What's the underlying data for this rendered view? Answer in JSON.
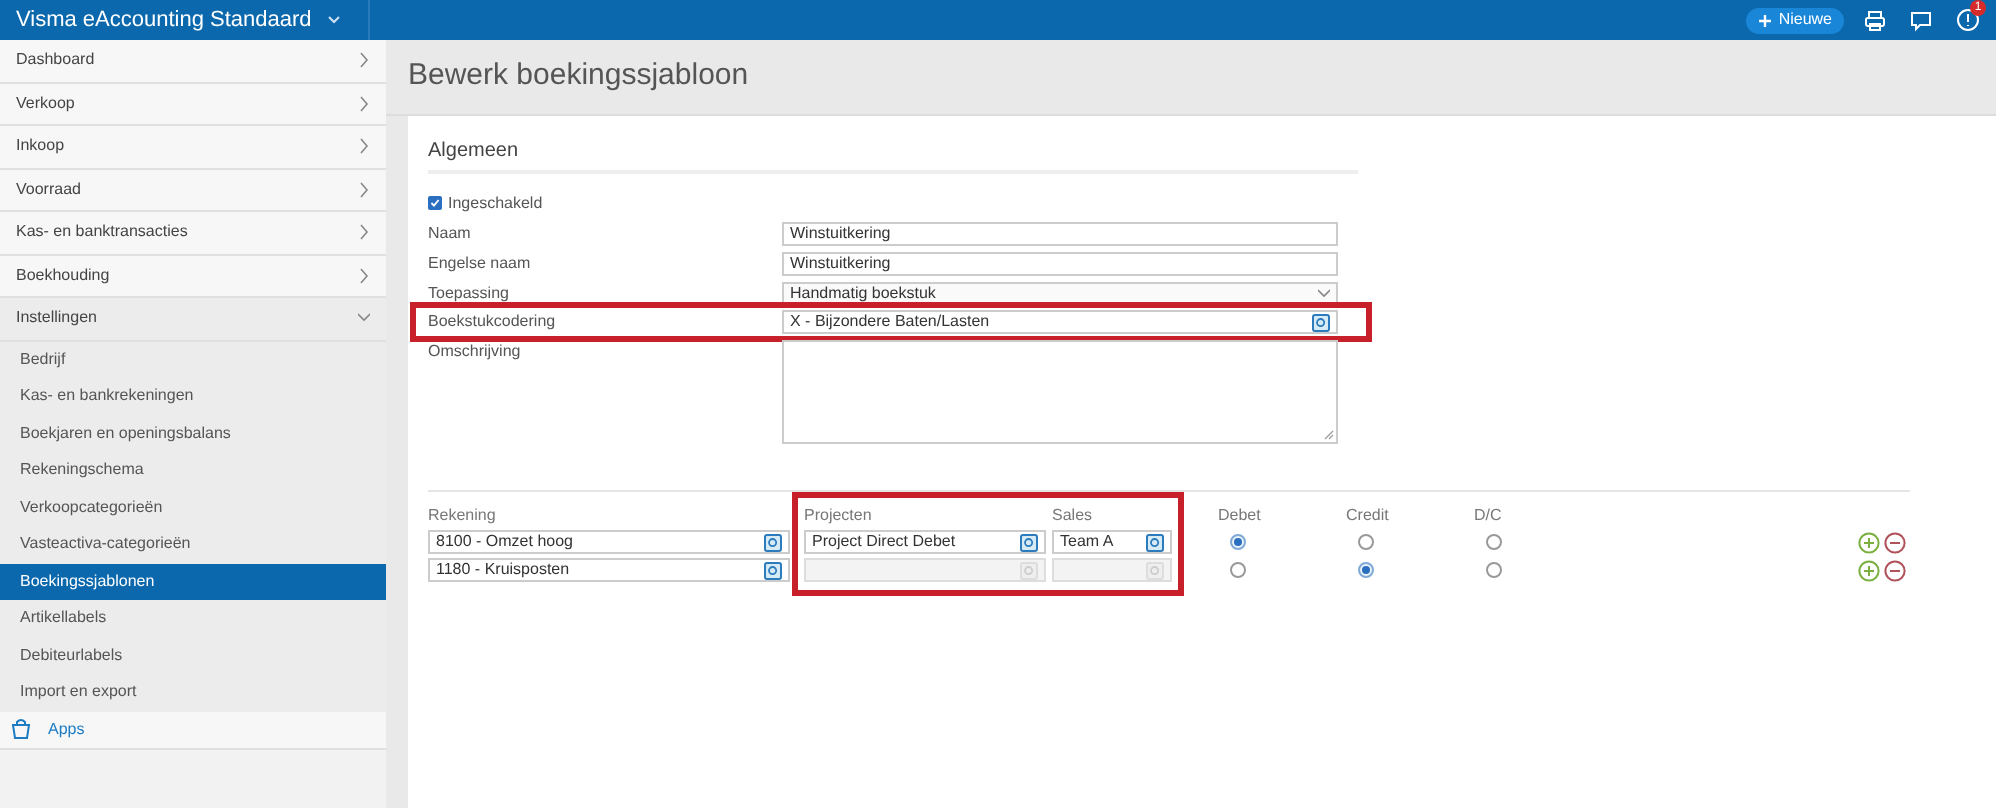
{
  "topbar": {
    "title": "Visma eAccounting Standaard",
    "new_button": "Nieuwe",
    "notification_count": "1"
  },
  "sidebar": {
    "items": [
      {
        "label": "Dashboard",
        "expanded": false
      },
      {
        "label": "Verkoop",
        "expanded": false
      },
      {
        "label": "Inkoop",
        "expanded": false
      },
      {
        "label": "Voorraad",
        "expanded": false
      },
      {
        "label": "Kas- en banktransacties",
        "expanded": false
      },
      {
        "label": "Boekhouding",
        "expanded": false
      },
      {
        "label": "Instellingen",
        "expanded": true,
        "children": [
          {
            "label": "Bedrijf",
            "selected": false
          },
          {
            "label": "Kas- en bankrekeningen",
            "selected": false
          },
          {
            "label": "Boekjaren en openingsbalans",
            "selected": false
          },
          {
            "label": "Rekeningschema",
            "selected": false
          },
          {
            "label": "Verkoopcategorieën",
            "selected": false
          },
          {
            "label": "Vasteactiva-categorieën",
            "selected": false
          },
          {
            "label": "Boekingssjablonen",
            "selected": true
          },
          {
            "label": "Artikellabels",
            "selected": false
          },
          {
            "label": "Debiteurlabels",
            "selected": false
          },
          {
            "label": "Import en export",
            "selected": false
          }
        ]
      }
    ],
    "apps": "Apps"
  },
  "page_title": "Bewerk boekingssjabloon",
  "section": {
    "title": "Algemeen",
    "enabled": {
      "label": "Ingeschakeld",
      "checked": true
    },
    "fields": [
      {
        "kind": "text",
        "label": "Naam",
        "value": "Winstuitkering",
        "highlighted": false
      },
      {
        "kind": "text",
        "label": "Engelse naam",
        "value": "Winstuitkering",
        "highlighted": false
      },
      {
        "kind": "select",
        "label": "Toepassing",
        "value": "Handmatig boekstuk",
        "highlighted": false
      },
      {
        "kind": "lookup",
        "label": "Boekstukcodering",
        "value": "X - Bijzondere Baten/Lasten",
        "highlighted": true
      },
      {
        "kind": "textarea",
        "label": "Omschrijving",
        "highlighted": false
      }
    ]
  },
  "lines": {
    "columns": [
      "Rekening",
      "Projecten",
      "Sales",
      "Debet",
      "Credit",
      "D/C"
    ],
    "dimensions_highlighted": true,
    "rows": [
      {
        "account": "8100 - Omzet hoog",
        "project": {
          "value": "Project Direct Debet",
          "disabled": false
        },
        "sales": {
          "value": "Team A",
          "disabled": false
        },
        "choices": [
          {
            "selected": true
          },
          {
            "selected": false
          },
          {
            "selected": false
          }
        ]
      },
      {
        "account": "1180 - Kruisposten",
        "project": {
          "disabled": true
        },
        "sales": {
          "disabled": true
        },
        "choices": [
          {
            "selected": false
          },
          {
            "selected": true
          },
          {
            "selected": false
          }
        ]
      }
    ]
  }
}
